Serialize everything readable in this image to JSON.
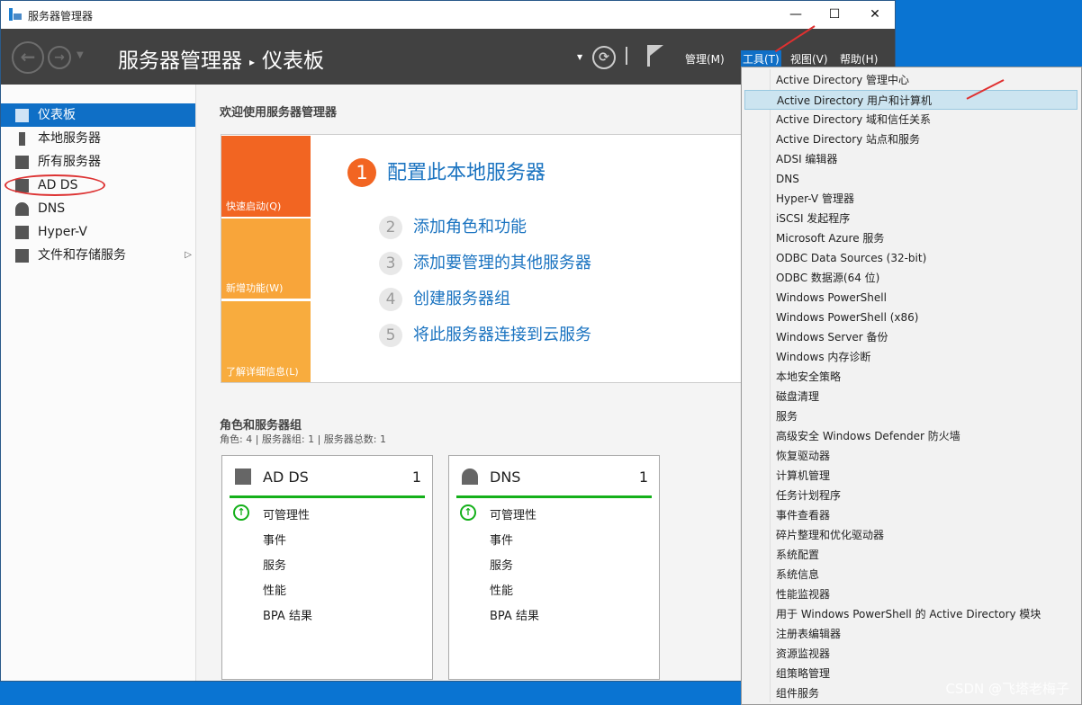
{
  "window": {
    "title": "服务器管理器",
    "minimize": "—",
    "maximize": "☐",
    "close": "✕"
  },
  "header": {
    "app": "服务器管理器",
    "sep": "▸",
    "page": "仪表板",
    "menus": [
      "管理(M)",
      "工具(T)",
      "视图(V)",
      "帮助(H)"
    ]
  },
  "sidebar": {
    "items": [
      {
        "label": "仪表板"
      },
      {
        "label": "本地服务器"
      },
      {
        "label": "所有服务器"
      },
      {
        "label": "AD DS"
      },
      {
        "label": "DNS"
      },
      {
        "label": "Hyper-V"
      },
      {
        "label": "文件和存储服务"
      }
    ]
  },
  "welcome": {
    "title": "欢迎使用服务器管理器",
    "tiles": [
      "快速启动(Q)",
      "新增功能(W)",
      "了解详细信息(L)"
    ],
    "steps": [
      {
        "n": "1",
        "label": "配置此本地服务器"
      },
      {
        "n": "2",
        "label": "添加角色和功能"
      },
      {
        "n": "3",
        "label": "添加要管理的其他服务器"
      },
      {
        "n": "4",
        "label": "创建服务器组"
      },
      {
        "n": "5",
        "label": "将此服务器连接到云服务"
      }
    ]
  },
  "roles": {
    "title": "角色和服务器组",
    "summary": "角色: 4 | 服务器组: 1 | 服务器总数: 1",
    "cards": [
      {
        "name": "AD DS",
        "count": "1",
        "rows": [
          "可管理性",
          "事件",
          "服务",
          "性能",
          "BPA 结果"
        ]
      },
      {
        "name": "DNS",
        "count": "1",
        "rows": [
          "可管理性",
          "事件",
          "服务",
          "性能",
          "BPA 结果"
        ]
      }
    ]
  },
  "tools_menu": [
    "Active Directory 管理中心",
    "Active Directory 用户和计算机",
    "Active Directory 域和信任关系",
    "Active Directory 站点和服务",
    "ADSI 编辑器",
    "DNS",
    "Hyper-V 管理器",
    "iSCSI 发起程序",
    "Microsoft Azure 服务",
    "ODBC Data Sources (32-bit)",
    "ODBC 数据源(64 位)",
    "Windows PowerShell",
    "Windows PowerShell (x86)",
    "Windows Server 备份",
    "Windows 内存诊断",
    "本地安全策略",
    "磁盘清理",
    "服务",
    "高级安全 Windows Defender 防火墙",
    "恢复驱动器",
    "计算机管理",
    "任务计划程序",
    "事件查看器",
    "碎片整理和优化驱动器",
    "系统配置",
    "系统信息",
    "性能监视器",
    "用于 Windows PowerShell 的 Active Directory 模块",
    "注册表编辑器",
    "资源监视器",
    "组策略管理",
    "组件服务"
  ],
  "watermark": "CSDN @飞塔老梅子",
  "colors": {
    "accent": "#0f6fc6",
    "orange": "#f26522",
    "green": "#14b01a"
  }
}
